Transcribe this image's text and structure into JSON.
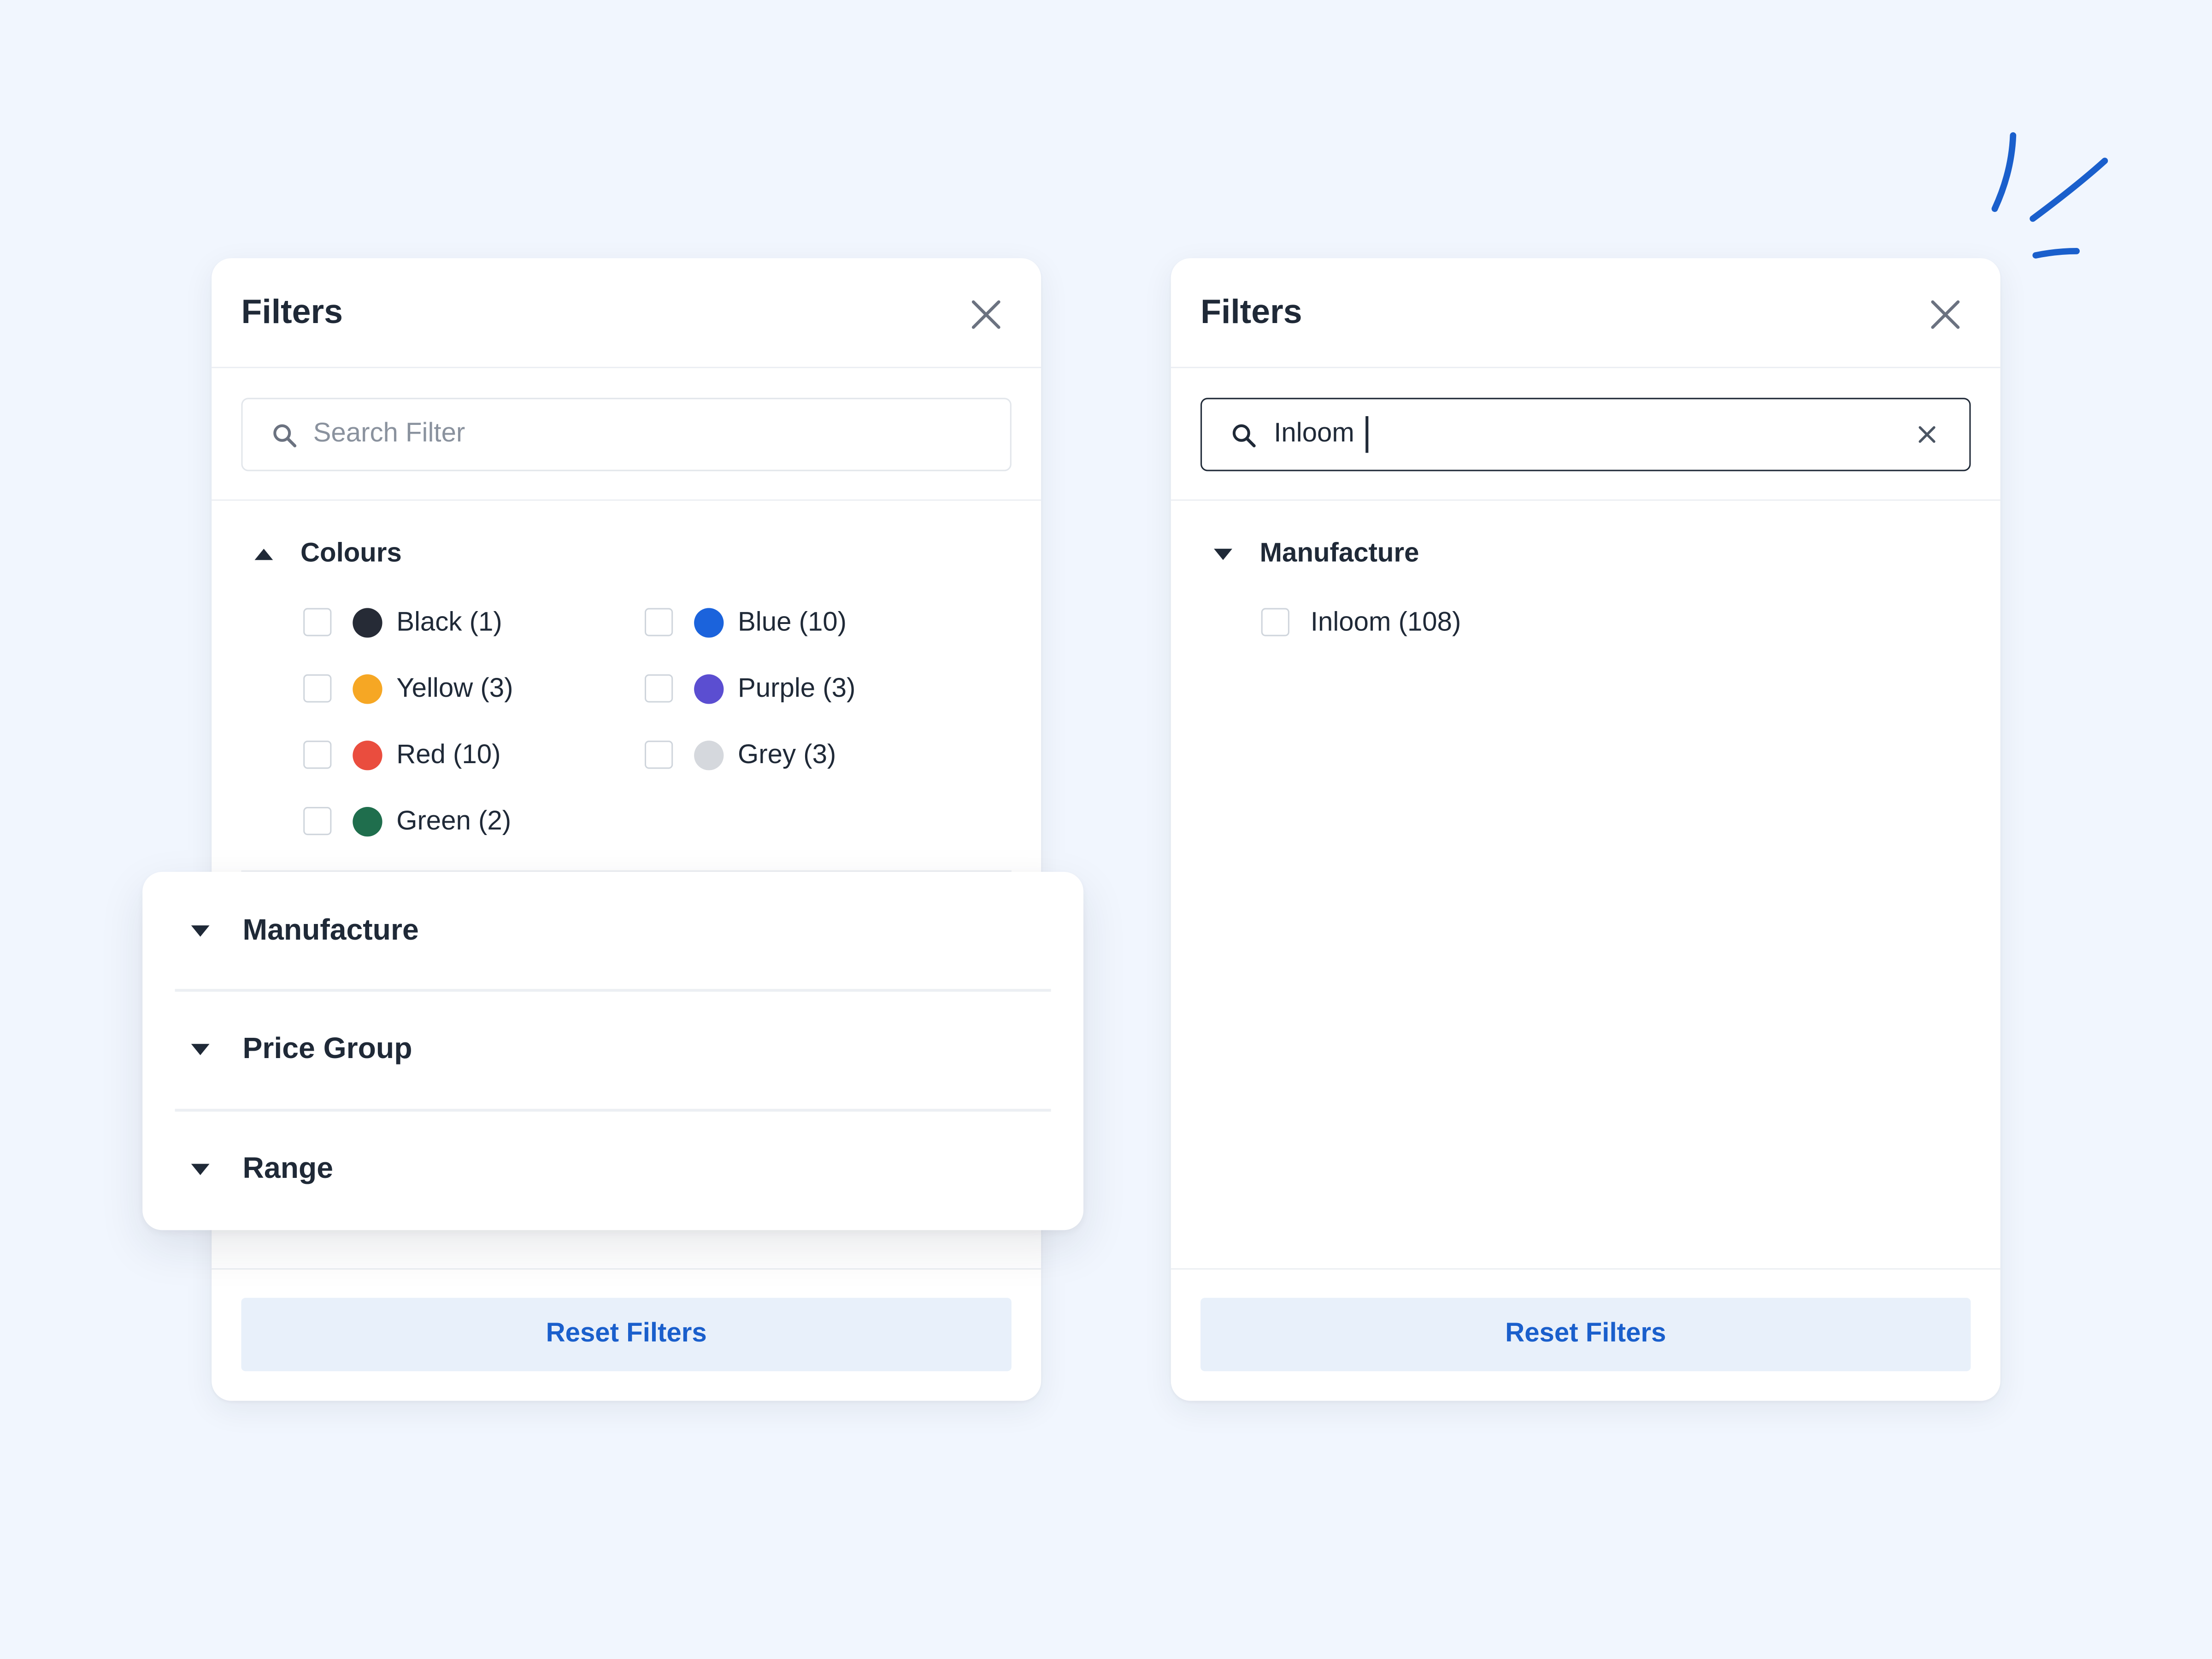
{
  "colors": {
    "background": "#f1f6fe",
    "accent": "#1a5fcc",
    "reset_button_bg": "#e8f0fa",
    "text_primary": "#1f2937",
    "placeholder": "#8a929e"
  },
  "left_panel": {
    "title": "Filters",
    "close_icon": "close-icon",
    "search": {
      "placeholder": "Search Filter",
      "value": "",
      "icon": "search-icon"
    },
    "colours_section": {
      "label": "Colours",
      "expanded": true,
      "options": [
        {
          "label": "Black (1)",
          "swatch": "#262b36",
          "checked": false
        },
        {
          "label": "Blue (10)",
          "swatch": "#1b63dc",
          "checked": false
        },
        {
          "label": "Yellow (3)",
          "swatch": "#f6a724",
          "checked": false
        },
        {
          "label": "Purple (3)",
          "swatch": "#5b4ed1",
          "checked": false
        },
        {
          "label": "Red (10)",
          "swatch": "#ea4d3e",
          "checked": false
        },
        {
          "label": "Grey (3)",
          "swatch": "#d5d8dd",
          "checked": false
        },
        {
          "label": "Green (2)",
          "swatch": "#1f6e4d",
          "checked": false
        }
      ]
    },
    "reset_label": "Reset Filters"
  },
  "overlay_sections": [
    {
      "label": "Manufacture",
      "expanded": false
    },
    {
      "label": "Price Group",
      "expanded": false
    },
    {
      "label": "Range",
      "expanded": false
    }
  ],
  "right_panel": {
    "title": "Filters",
    "close_icon": "close-icon",
    "search": {
      "value": "Inloom",
      "icon": "search-icon",
      "clear_icon": "clear-icon"
    },
    "manufacture_section": {
      "label": "Manufacture",
      "expanded": true,
      "options": [
        {
          "label": "Inloom (108)",
          "checked": false
        }
      ]
    },
    "reset_label": "Reset Filters"
  }
}
